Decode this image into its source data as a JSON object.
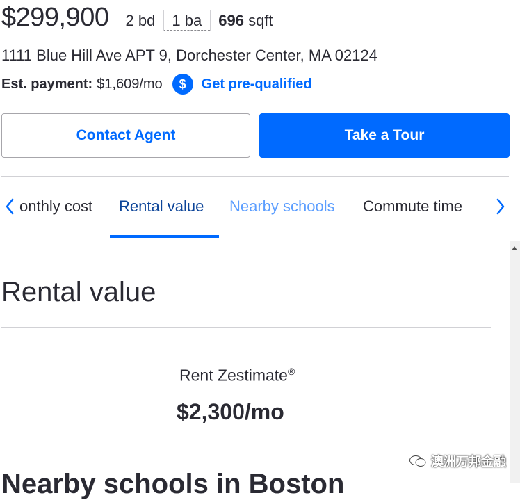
{
  "listing": {
    "price": "$299,900",
    "beds_num": "2",
    "beds_unit": "bd",
    "baths_num": "1",
    "baths_unit": "ba",
    "sqft_num": "696",
    "sqft_unit": "sqft",
    "address": "1111 Blue Hill Ave APT 9, Dorchester Center, MA 02124",
    "payment_label": "Est. payment:",
    "payment_value": "$1,609/mo",
    "dollar_glyph": "$",
    "prequal_link": "Get pre-qualified"
  },
  "actions": {
    "contact_label": "Contact Agent",
    "tour_label": "Take a Tour"
  },
  "tabs": {
    "prev_glyph": "‹",
    "next_glyph": "›",
    "items": [
      {
        "label": "onthly cost"
      },
      {
        "label": "Rental value"
      },
      {
        "label": "Nearby schools"
      },
      {
        "label": "Commute time"
      }
    ],
    "active": "Rental value"
  },
  "rental": {
    "section_title": "Rental value",
    "zestimate_label": "Rent Zestimate",
    "zestimate_mark": "®",
    "zestimate_value": "$2,300/mo"
  },
  "next_section": {
    "heading": "Nearby schools in Boston"
  },
  "watermark": {
    "text": "澳洲万邦金融"
  },
  "colors": {
    "accent": "#006aff",
    "text": "#2a2a33",
    "active_tab": "#0d4599",
    "divider": "#d1d1d5"
  },
  "icons": [
    "dollar-icon",
    "chevron-left-icon",
    "chevron-right-icon",
    "wechat-icon"
  ]
}
